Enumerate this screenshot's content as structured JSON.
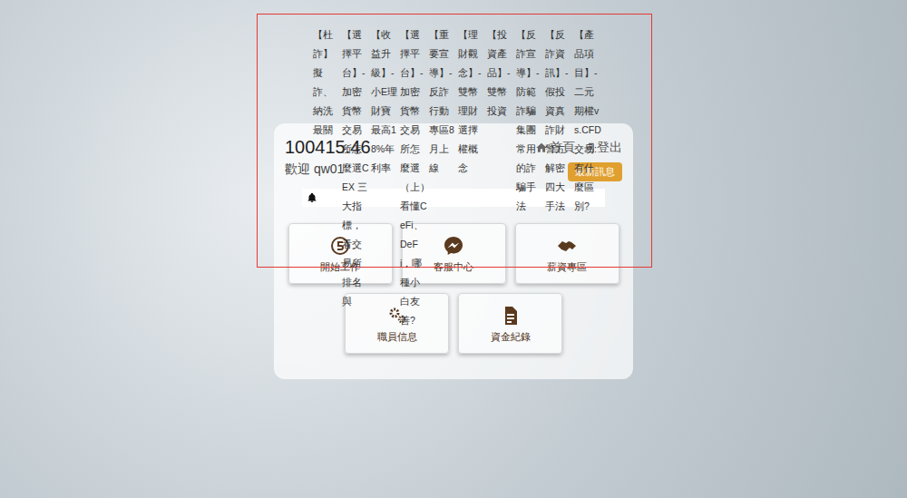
{
  "balance": "100415.46",
  "welcome": "歡迎 qw01",
  "nav": [
    {
      "label": "首頁"
    },
    {
      "label": "登出"
    }
  ],
  "news_button": "最新訊息",
  "menu_rows": [
    [
      {
        "label": "開始工作"
      },
      {
        "label": "客服中心"
      },
      {
        "label": "薪資專區"
      }
    ],
    [
      {
        "label": "職員信息"
      },
      {
        "label": "資金紀錄"
      }
    ]
  ],
  "news_list": [
    "【杜詐】擬詐、納洗最關",
    "【選擇平台】- 加密貨幣交易所怎麼選CEX 三大指標，看交易所排名與",
    "【收益升級】- 小E理財寶最高18%年利率",
    "【選擇平台】- 加密貨幣交易所怎麼選（上）看懂CeFi、DeFi，哪種小白友善?",
    "【重要宣導】- 反詐行動專區8月上線",
    "【理財觀念】- 雙幣理財選擇權概念",
    "【投資產品】- 雙幣投資",
    "【反詐宣導】- 防範詐騙集團常用的詐騙手法",
    "【反詐資訊】- 假投資真詐財警方解密四大手法",
    "【產品項目】- 二元期權vs.CFD交易:有什麼區別?"
  ]
}
